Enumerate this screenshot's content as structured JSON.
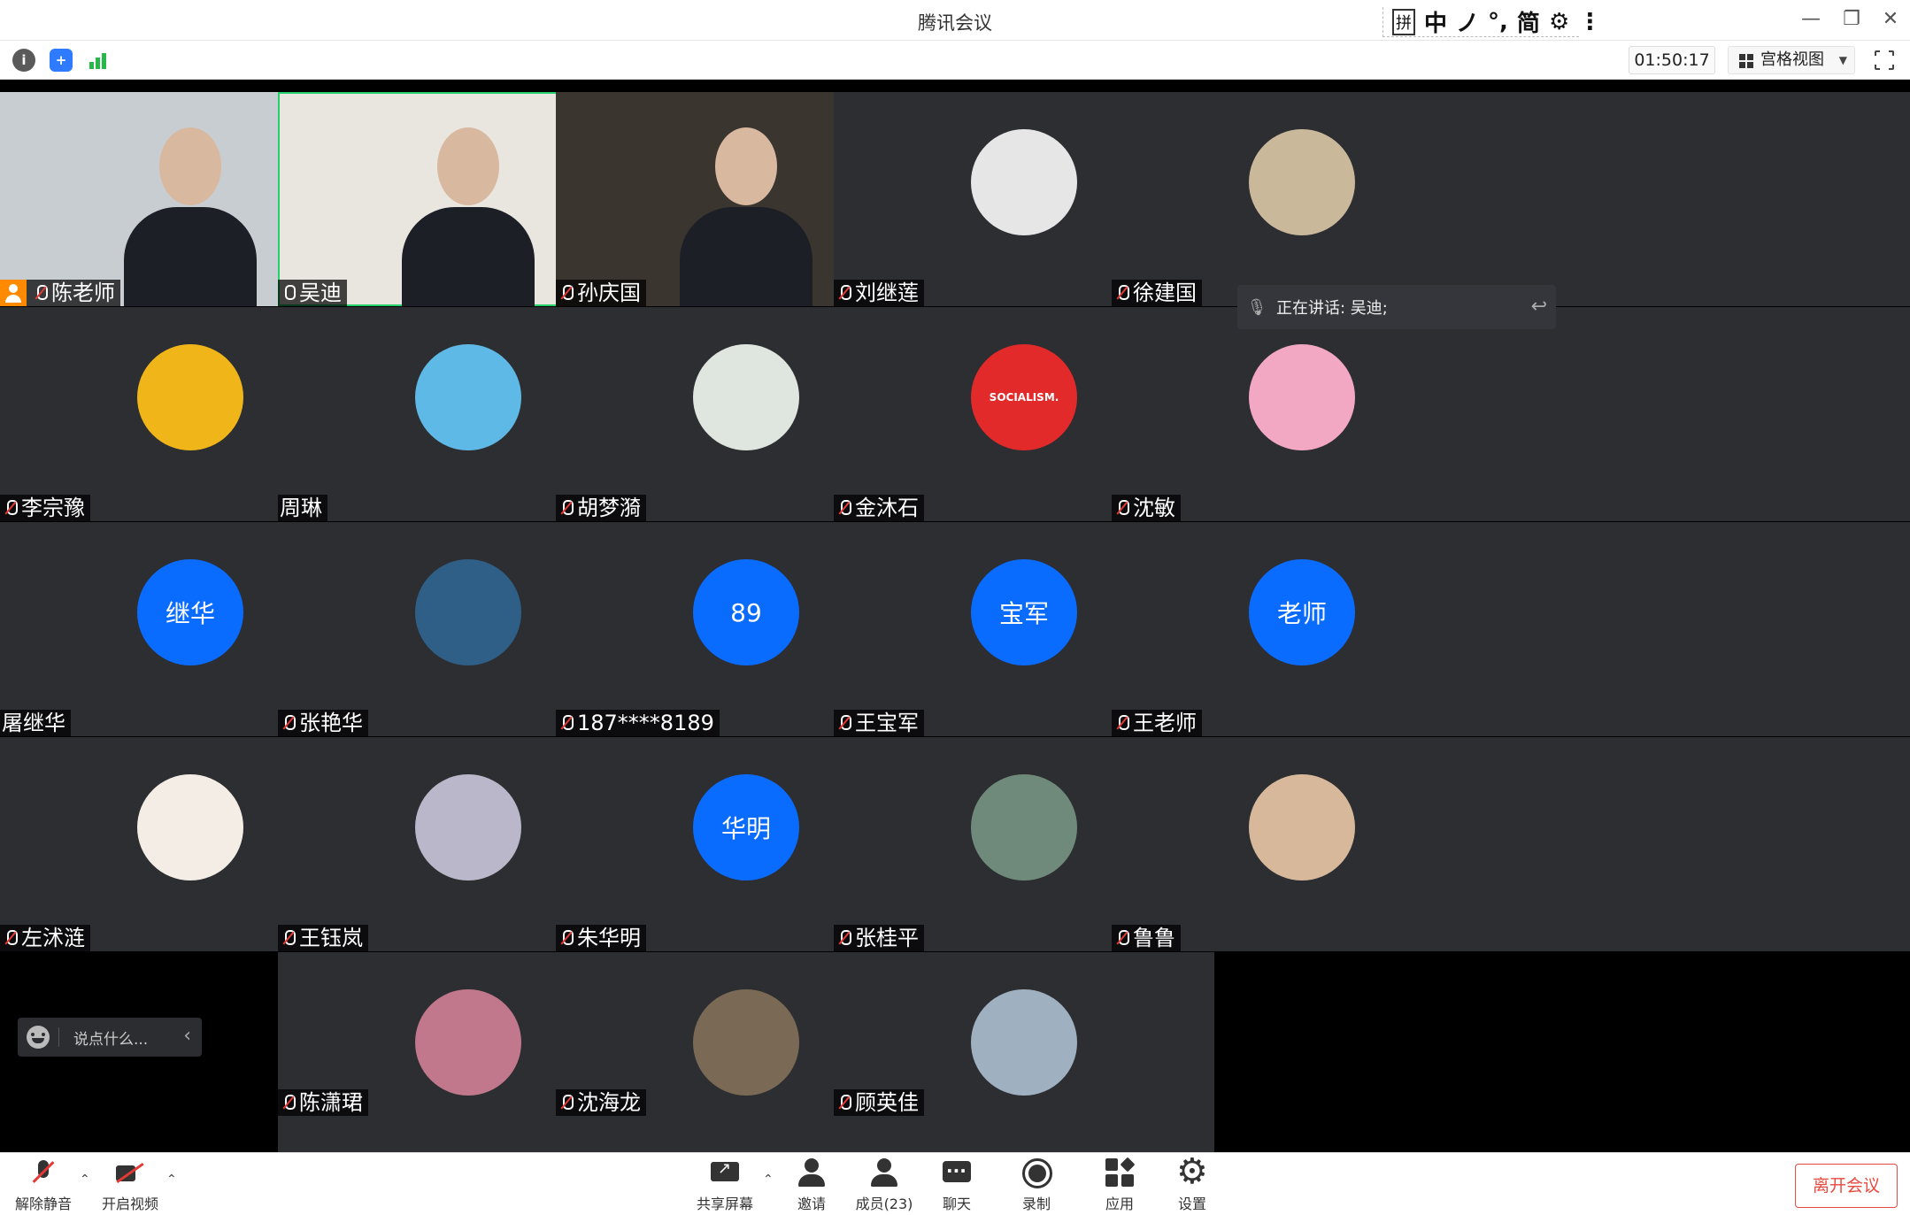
{
  "window": {
    "title": "腾讯会议",
    "ime": [
      "拼",
      "中",
      "ノ",
      "°,",
      "简",
      "⚙",
      "⋮"
    ]
  },
  "infobar": {
    "timer": "01:50:17",
    "view_mode": "宫格视图"
  },
  "participants": [
    {
      "name": "陈老师",
      "mic": "muted",
      "host": true,
      "kind": "video",
      "bg": "#c8cdd2"
    },
    {
      "name": "吴迪",
      "mic": "on",
      "kind": "video",
      "bg": "#e9e6e0",
      "active": true
    },
    {
      "name": "孙庆国",
      "mic": "muted",
      "kind": "video",
      "bg": "#3b3530"
    },
    {
      "name": "刘继莲",
      "mic": "muted",
      "kind": "avatar",
      "color": "#e6e6e6"
    },
    {
      "name": "徐建国",
      "mic": "muted",
      "kind": "avatar",
      "color": "#c9b89a"
    },
    {
      "name": "李宗豫",
      "mic": "muted",
      "kind": "avatar",
      "color": "#f0b619"
    },
    {
      "name": "周琳",
      "mic": "none",
      "kind": "avatar",
      "color": "#5fb9e6"
    },
    {
      "name": "胡梦漪",
      "mic": "muted",
      "kind": "avatar",
      "color": "#dfe6df"
    },
    {
      "name": "金沐石",
      "mic": "muted",
      "kind": "avatar",
      "color": "#e32a2a",
      "avatar_text": "SOCIALISM."
    },
    {
      "name": "沈敏",
      "mic": "muted",
      "kind": "avatar",
      "color": "#f2a7c2"
    },
    {
      "name": "屠继华",
      "mic": "none",
      "kind": "initials",
      "avatar_text": "继华"
    },
    {
      "name": "张艳华",
      "mic": "muted",
      "kind": "avatar",
      "color": "#2f5f86"
    },
    {
      "name": "187****8189",
      "mic": "muted",
      "kind": "initials",
      "avatar_text": "89"
    },
    {
      "name": "王宝军",
      "mic": "muted",
      "kind": "initials",
      "avatar_text": "宝军"
    },
    {
      "name": "王老师",
      "mic": "muted",
      "kind": "initials",
      "avatar_text": "老师"
    },
    {
      "name": "左沭涟",
      "mic": "muted",
      "kind": "avatar",
      "color": "#f4ede6"
    },
    {
      "name": "王钰岚",
      "mic": "muted",
      "kind": "avatar",
      "color": "#b9b7c9"
    },
    {
      "name": "朱华明",
      "mic": "muted",
      "kind": "initials",
      "avatar_text": "华明"
    },
    {
      "name": "张桂平",
      "mic": "muted",
      "kind": "avatar",
      "color": "#6f8a7a"
    },
    {
      "name": "鲁鲁",
      "mic": "muted",
      "kind": "avatar",
      "color": "#d7b89b"
    },
    {
      "name": "陈潇珺",
      "mic": "muted",
      "kind": "avatar",
      "color": "#c1778c"
    },
    {
      "name": "沈海龙",
      "mic": "muted",
      "kind": "avatar",
      "color": "#7a6a55"
    },
    {
      "name": "顾英佳",
      "mic": "muted",
      "kind": "avatar",
      "color": "#9fb0c0"
    }
  ],
  "speaking": {
    "text": "正在讲话: 吴迪;"
  },
  "chat": {
    "placeholder": "说点什么..."
  },
  "toolbar": {
    "unmute": "解除静音",
    "start_video": "开启视频",
    "share_screen": "共享屏幕",
    "invite": "邀请",
    "members": "成员(23)",
    "chat": "聊天",
    "record": "录制",
    "apps": "应用",
    "settings": "设置",
    "leave": "离开会议"
  },
  "colors": {
    "accent_blue": "#0a6cff",
    "leave_red": "#e84a3f",
    "tile_bg": "#2d2e32",
    "active_border": "#26d16b"
  }
}
